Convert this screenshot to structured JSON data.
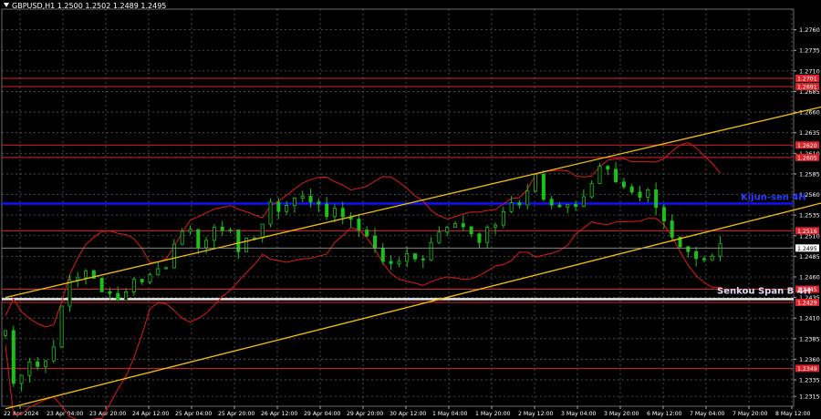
{
  "header": {
    "title": "GBPUSD,H1  1.2500 1.2502 1.2489 1.2495"
  },
  "chart_data": {
    "type": "candlestick",
    "symbol": "GBPUSD",
    "timeframe": "H1",
    "ohlc_last": {
      "open": 1.25,
      "high": 1.2502,
      "low": 1.2489,
      "close": 1.2495
    },
    "current_price": 1.2495,
    "ylim": [
      1.2303,
      1.2785
    ],
    "y_ticks": [
      1.2315,
      1.2335,
      1.236,
      1.2385,
      1.241,
      1.2435,
      1.246,
      1.2485,
      1.251,
      1.2535,
      1.256,
      1.2585,
      1.261,
      1.2635,
      1.266,
      1.2685,
      1.271,
      1.2735,
      1.276
    ],
    "y_tick_labels": [
      "1.2315",
      "1.2335",
      "1.2360",
      "1.2385",
      "1.2410",
      "1.2435",
      "1.2460",
      "1.2485",
      "1.2510",
      "1.2535",
      "1.2560",
      "1.2585",
      "1.2610",
      "1.2635",
      "1.2660",
      "1.2685",
      "1.2710",
      "1.2735",
      "1.2760"
    ],
    "x_tick_labels": [
      "22 Apr 2024",
      "23 Apr 04:00",
      "23 Apr 20:00",
      "24 Apr 12:00",
      "25 Apr 04:00",
      "25 Apr 20:00",
      "26 Apr 12:00",
      "29 Apr 04:00",
      "29 Apr 20:00",
      "30 Apr 12:00",
      "1 May 04:00",
      "1 May 20:00",
      "2 May 12:00",
      "3 May 04:00",
      "3 May 20:00",
      "6 May 12:00",
      "7 May 04:00",
      "7 May 20:00",
      "8 May 12:00"
    ],
    "grid": true,
    "levels": [
      {
        "price": 1.2701,
        "label": "1.2701",
        "color": "#d9242b"
      },
      {
        "price": 1.2691,
        "label": "1.2691",
        "color": "#d9242b"
      },
      {
        "price": 1.262,
        "label": "1.2620",
        "color": "#d9242b"
      },
      {
        "price": 1.2605,
        "label": "1.2605",
        "color": "#d9242b"
      },
      {
        "price": 1.2516,
        "label": "1.2516",
        "color": "#d9242b"
      },
      {
        "price": 1.2445,
        "label": "1.2445",
        "color": "#d9242b"
      },
      {
        "price": 1.2429,
        "label": "1.2429",
        "color": "#d9242b"
      },
      {
        "price": 1.2349,
        "label": "1.2349",
        "color": "#d9242b"
      }
    ],
    "kijun_sen": {
      "price": 1.2549,
      "label": "Kijun-sen 4H",
      "color": "#1010ff"
    },
    "senkou_span_b": {
      "price": 1.2433,
      "label": "Senkou Span B 4H",
      "color": "#e8e8e8"
    },
    "channel": {
      "color": "#f5c000",
      "upper": [
        [
          0,
          1.2435
        ],
        [
          105,
          1.2674
        ]
      ],
      "lower": [
        [
          0,
          1.23
        ],
        [
          105,
          1.2558
        ]
      ]
    },
    "price_path": [
      [
        0,
        1.2395
      ],
      [
        1,
        1.233
      ],
      [
        2,
        1.2345
      ],
      [
        3,
        1.236
      ],
      [
        4,
        1.2352
      ],
      [
        5,
        1.2358
      ],
      [
        6,
        1.238
      ],
      [
        7,
        1.242
      ],
      [
        8,
        1.2455
      ],
      [
        9,
        1.246
      ],
      [
        10,
        1.247
      ],
      [
        11,
        1.2455
      ],
      [
        12,
        1.244
      ],
      [
        13,
        1.2445
      ],
      [
        14,
        1.2432
      ],
      [
        15,
        1.2445
      ],
      [
        16,
        1.2455
      ],
      [
        17,
        1.2458
      ],
      [
        18,
        1.2462
      ],
      [
        19,
        1.247
      ],
      [
        20,
        1.2475
      ],
      [
        21,
        1.2505
      ],
      [
        22,
        1.251
      ],
      [
        23,
        1.2512
      ],
      [
        24,
        1.25
      ],
      [
        25,
        1.2505
      ],
      [
        26,
        1.2515
      ],
      [
        27,
        1.252
      ],
      [
        28,
        1.2518
      ],
      [
        29,
        1.249
      ],
      [
        30,
        1.2505
      ],
      [
        31,
        1.251
      ],
      [
        32,
        1.2528
      ],
      [
        33,
        1.2545
      ],
      [
        34,
        1.254
      ],
      [
        35,
        1.255
      ],
      [
        36,
        1.2555
      ],
      [
        37,
        1.256
      ],
      [
        38,
        1.2555
      ],
      [
        39,
        1.2545
      ],
      [
        40,
        1.2535
      ],
      [
        41,
        1.2545
      ],
      [
        42,
        1.2538
      ],
      [
        43,
        1.2525
      ],
      [
        44,
        1.252
      ],
      [
        45,
        1.2505
      ],
      [
        46,
        1.2495
      ],
      [
        47,
        1.2482
      ],
      [
        48,
        1.2475
      ],
      [
        49,
        1.248
      ],
      [
        50,
        1.2485
      ],
      [
        51,
        1.248
      ],
      [
        52,
        1.2485
      ],
      [
        53,
        1.2505
      ],
      [
        54,
        1.2515
      ],
      [
        55,
        1.2525
      ],
      [
        56,
        1.253
      ],
      [
        57,
        1.2522
      ],
      [
        58,
        1.251
      ],
      [
        59,
        1.25
      ],
      [
        60,
        1.2515
      ],
      [
        61,
        1.2525
      ],
      [
        62,
        1.254
      ],
      [
        63,
        1.255
      ],
      [
        64,
        1.2548
      ],
      [
        65,
        1.256
      ],
      [
        66,
        1.2585
      ],
      [
        67,
        1.2555
      ],
      [
        68,
        1.255
      ],
      [
        69,
        1.2548
      ],
      [
        70,
        1.2545
      ],
      [
        71,
        1.255
      ],
      [
        72,
        1.256
      ],
      [
        73,
        1.257
      ],
      [
        74,
        1.259
      ],
      [
        75,
        1.2585
      ],
      [
        76,
        1.257
      ],
      [
        77,
        1.2565
      ],
      [
        78,
        1.256
      ],
      [
        79,
        1.2555
      ],
      [
        80,
        1.2565
      ],
      [
        81,
        1.255
      ],
      [
        82,
        1.253
      ],
      [
        83,
        1.251
      ],
      [
        84,
        1.25
      ],
      [
        85,
        1.2492
      ],
      [
        86,
        1.248
      ],
      [
        87,
        1.2478
      ],
      [
        88,
        1.2488
      ],
      [
        89,
        1.2495
      ]
    ],
    "n_bars": 90
  }
}
